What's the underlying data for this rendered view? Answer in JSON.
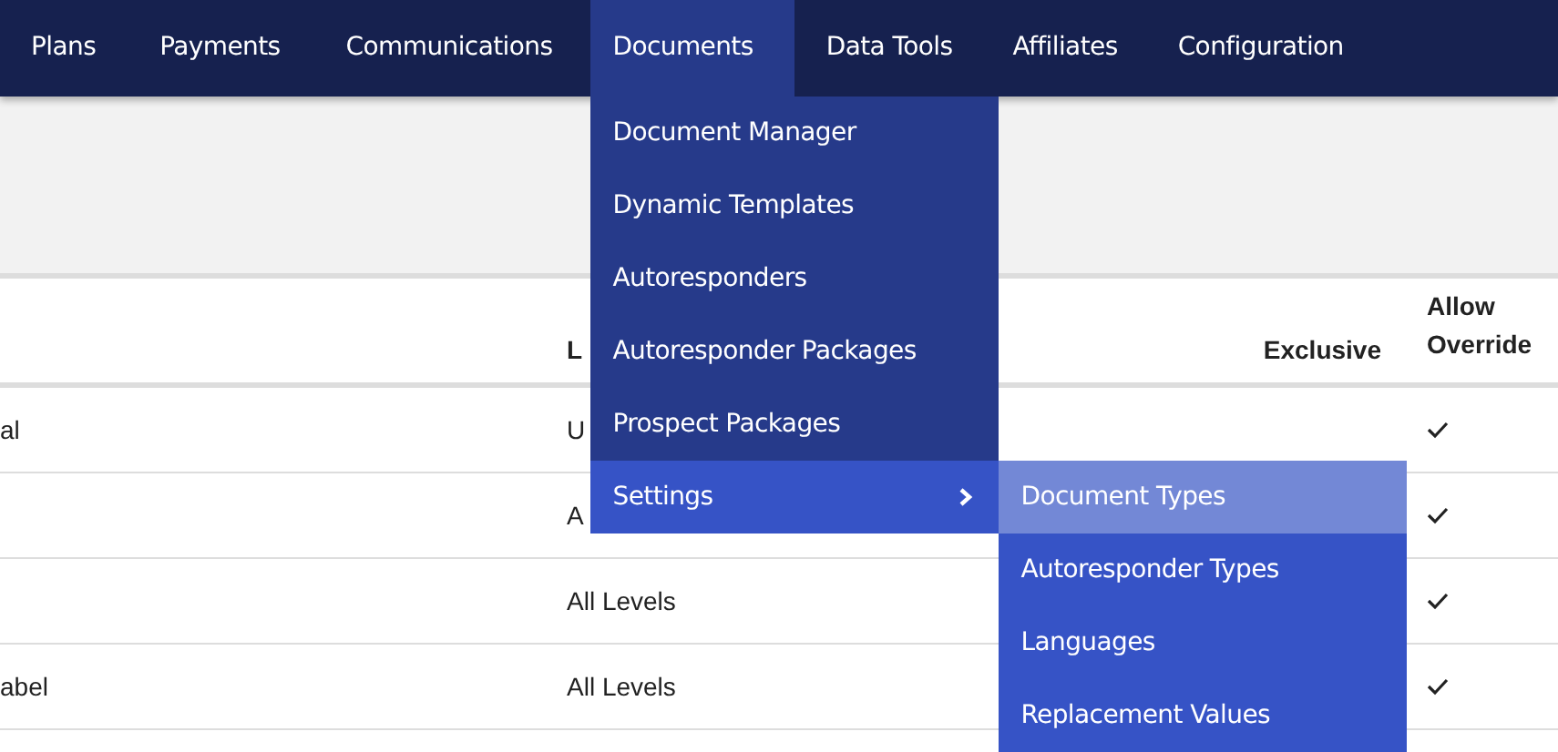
{
  "nav": [
    {
      "label": "Plans",
      "selected": false
    },
    {
      "label": "Payments",
      "selected": false
    },
    {
      "label": "Communications",
      "selected": false
    },
    {
      "label": "Documents",
      "selected": true
    },
    {
      "label": "Data Tools",
      "selected": false
    },
    {
      "label": "Affiliates",
      "selected": false
    },
    {
      "label": "Configuration",
      "selected": false
    }
  ],
  "documents_menu": [
    {
      "label": "Document Manager",
      "kind": "link",
      "selected": false
    },
    {
      "label": "Dynamic Templates",
      "kind": "link",
      "selected": false
    },
    {
      "label": "Autoresponders",
      "kind": "link",
      "selected": false
    },
    {
      "label": "Autoresponder Packages",
      "kind": "link",
      "selected": false
    },
    {
      "label": "Prospect Packages",
      "kind": "link",
      "selected": false
    },
    {
      "label": "Settings",
      "kind": "submenu",
      "selected": true
    }
  ],
  "settings_submenu": [
    {
      "label": "Document Types",
      "selected": true
    },
    {
      "label": "Autoresponder Types",
      "selected": false
    },
    {
      "label": "Languages",
      "selected": false
    },
    {
      "label": "Replacement Values",
      "selected": false
    }
  ],
  "table": {
    "header": {
      "column_2": "L",
      "exclusive": "Exclusive",
      "allow_override": "Allow Override"
    },
    "rows": [
      {
        "column_1": "al",
        "column_2": "U",
        "allow_override": true
      },
      {
        "column_2": "A",
        "allow_override": true
      },
      {
        "column_2": "All Levels",
        "allow_override": true
      },
      {
        "column_1": "abel",
        "column_2": "All Levels",
        "allow_override": true
      }
    ]
  }
}
